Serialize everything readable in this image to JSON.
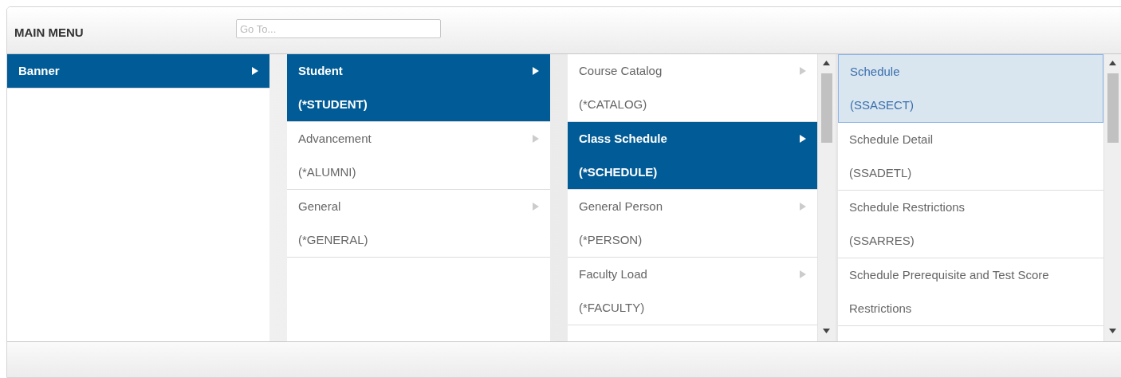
{
  "header": {
    "title": "MAIN MENU",
    "search": {
      "placeholder": "Go To..."
    }
  },
  "columns": [
    {
      "scrollable": false,
      "items": [
        {
          "title": "Banner",
          "has_submenu": true,
          "selected": true
        }
      ]
    },
    {
      "scrollable": false,
      "items": [
        {
          "title": "Student",
          "code": "(*STUDENT)",
          "has_submenu": true,
          "selected": true
        },
        {
          "title": "Advancement",
          "code": "(*ALUMNI)",
          "has_submenu": true,
          "selected": false
        },
        {
          "title": "General",
          "code": "(*GENERAL)",
          "has_submenu": true,
          "selected": false
        }
      ]
    },
    {
      "scrollable": true,
      "items": [
        {
          "title": "Course Catalog",
          "code": "(*CATALOG)",
          "has_submenu": true,
          "selected": false
        },
        {
          "title": "Class Schedule",
          "code": "(*SCHEDULE)",
          "has_submenu": true,
          "selected": true
        },
        {
          "title": "General Person",
          "code": "(*PERSON)",
          "has_submenu": true,
          "selected": false
        },
        {
          "title": "Faculty Load",
          "code": "(*FACULTY)",
          "has_submenu": true,
          "selected": false
        }
      ]
    },
    {
      "scrollable": true,
      "kind": "forms",
      "items": [
        {
          "title": "Schedule",
          "code": "(SSASECT)",
          "has_submenu": false,
          "selected": true
        },
        {
          "title": "Schedule Detail",
          "code": "(SSADETL)",
          "has_submenu": false,
          "selected": false
        },
        {
          "title": "Schedule Restrictions",
          "code": "(SSARRES)",
          "has_submenu": false,
          "selected": false
        },
        {
          "title": "Schedule Prerequisite and Test Score Restrictions",
          "has_submenu": false,
          "selected": false
        }
      ]
    }
  ]
}
